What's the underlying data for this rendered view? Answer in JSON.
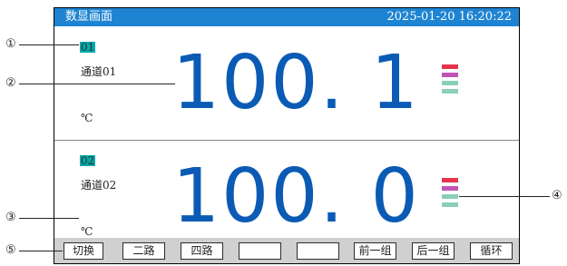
{
  "title": "数显画面",
  "datetime": "2025-01-20  16:20:22",
  "channels": [
    {
      "number": "01",
      "name": "通道01",
      "value": "100. 1",
      "unit": "℃"
    },
    {
      "number": "02",
      "name": "通道02",
      "value": "100. 0",
      "unit": "℃"
    }
  ],
  "legend_colors": [
    "#e8344a",
    "#c054b4",
    "#8ad0b4",
    "#8ad0b4"
  ],
  "accent_colors": {
    "titlebar": "#1e84d2",
    "value_text": "#0b5bb5",
    "channel_tag": "#00a8a8",
    "button_bar": "#d0d0d0"
  },
  "buttons": [
    "切换",
    "二路",
    "四路",
    "",
    "",
    "前一组",
    "后一组",
    "循环"
  ],
  "callouts": [
    "①",
    "②",
    "③",
    "④",
    "⑤"
  ]
}
